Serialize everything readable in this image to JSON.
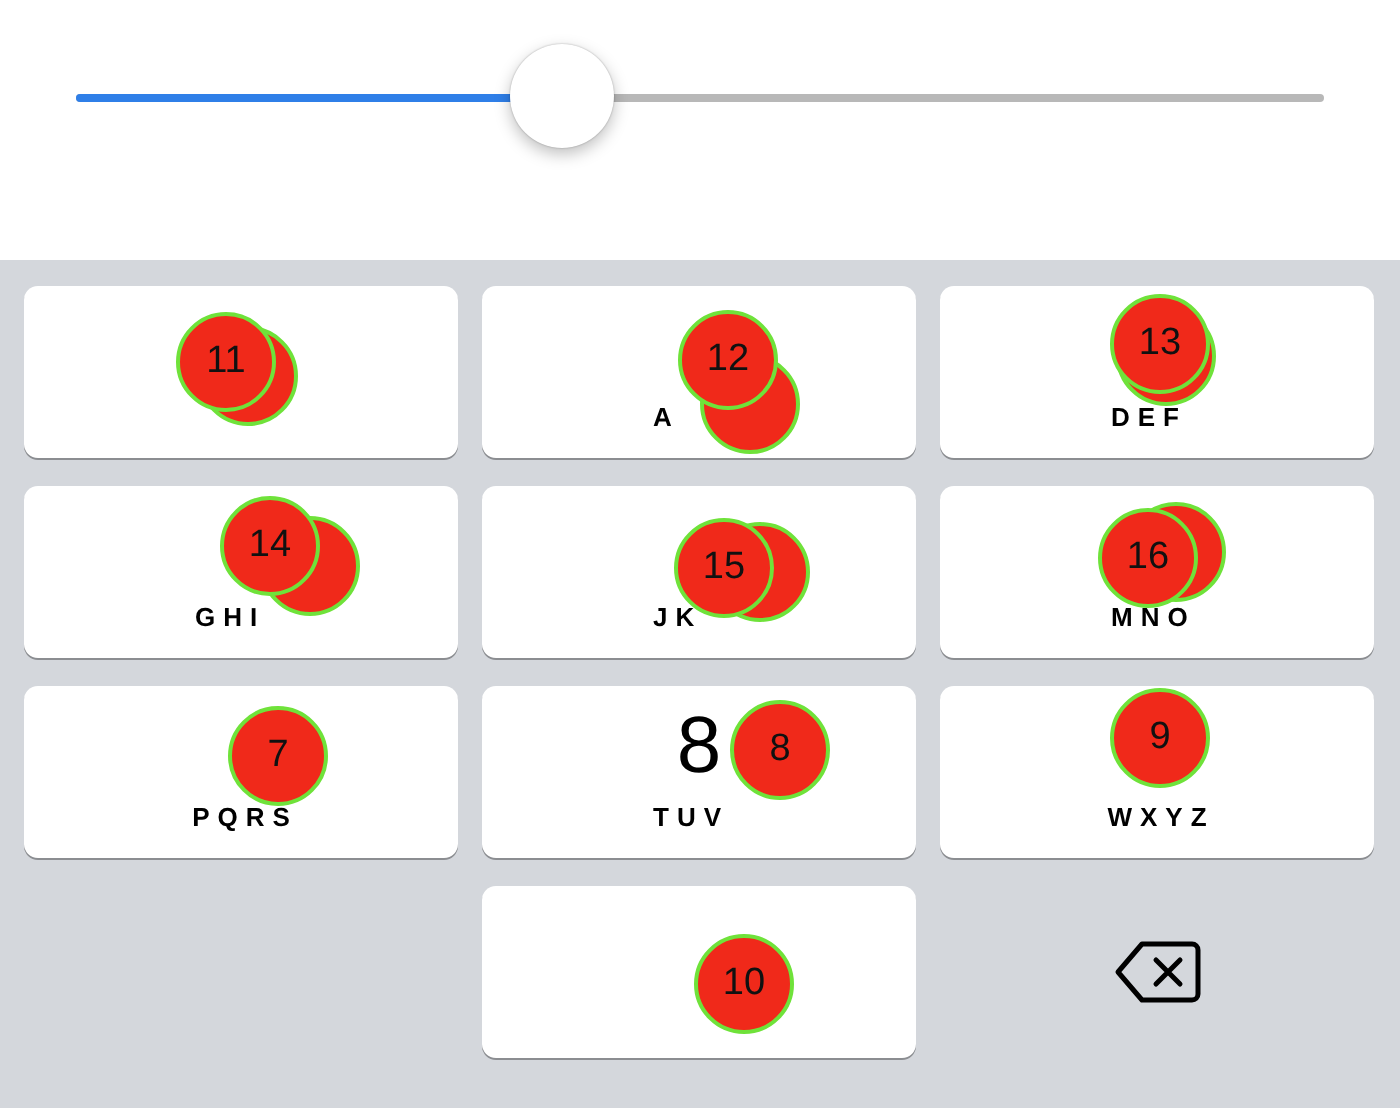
{
  "slider": {
    "level": 0.39
  },
  "keys": [
    {
      "kind": "digit"
    },
    {
      "kind": "digit",
      "letters": "A"
    },
    {
      "kind": "digit",
      "letters": "DEF"
    },
    {
      "kind": "digit",
      "letters": "GHI"
    },
    {
      "kind": "digit",
      "letters": "JK"
    },
    {
      "kind": "digit",
      "letters": "MNO"
    },
    {
      "kind": "digit",
      "letters": "PQRS"
    },
    {
      "kind": "digit",
      "digit": "8",
      "letters": "TUV"
    },
    {
      "kind": "digit",
      "letters": "WXYZ"
    },
    {
      "kind": "blank"
    },
    {
      "kind": "digit"
    },
    {
      "kind": "delete"
    }
  ],
  "touch_markers": [
    {
      "number": "11",
      "doubled": true
    },
    {
      "number": "12",
      "doubled": true
    },
    {
      "number": "13",
      "doubled": true
    },
    {
      "number": "14",
      "doubled": true
    },
    {
      "number": "15",
      "doubled": true
    },
    {
      "number": "16",
      "doubled": true
    },
    {
      "number": "7",
      "doubled": false
    },
    {
      "number": "8",
      "doubled": false
    },
    {
      "number": "9",
      "doubled": false
    },
    {
      "number": "10",
      "doubled": false
    }
  ]
}
